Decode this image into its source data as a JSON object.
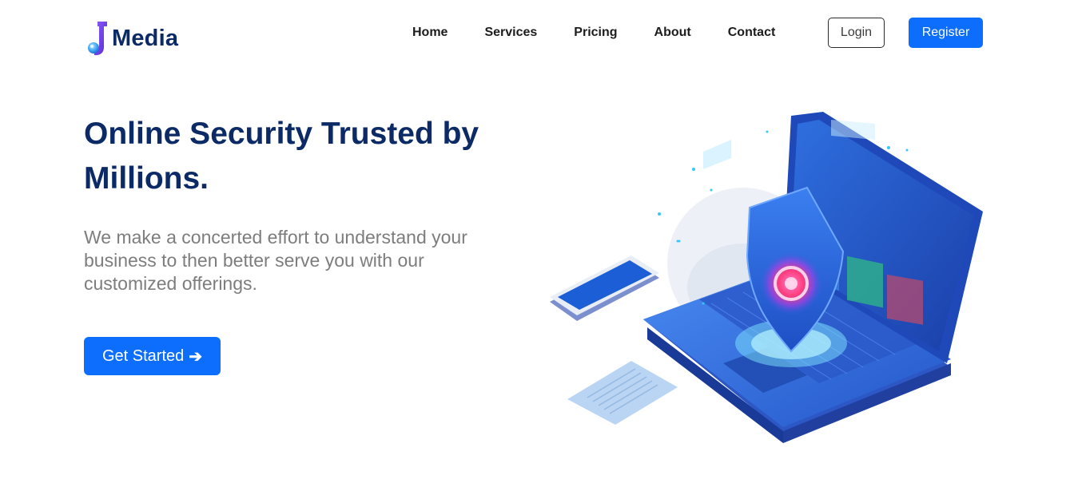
{
  "header": {
    "logo_text": "Media",
    "logo_icon": "j-letter-logo",
    "nav": [
      {
        "label": "Home"
      },
      {
        "label": "Services"
      },
      {
        "label": "Pricing"
      },
      {
        "label": "About"
      },
      {
        "label": "Contact"
      }
    ],
    "login_label": "Login",
    "register_label": "Register"
  },
  "hero": {
    "title": "Online Security Trusted by Millions.",
    "description": "We make a concerted effort to understand your business to then better serve you with our customized offerings.",
    "cta_label": "Get Started",
    "cta_icon": "arrow-right-icon",
    "illustration": "laptop-shield-security-illustration"
  },
  "colors": {
    "primary": "#0d6efd",
    "heading": "#0b2a66",
    "body_text": "#7d7d7d",
    "nav_text": "#1c1c1c"
  }
}
